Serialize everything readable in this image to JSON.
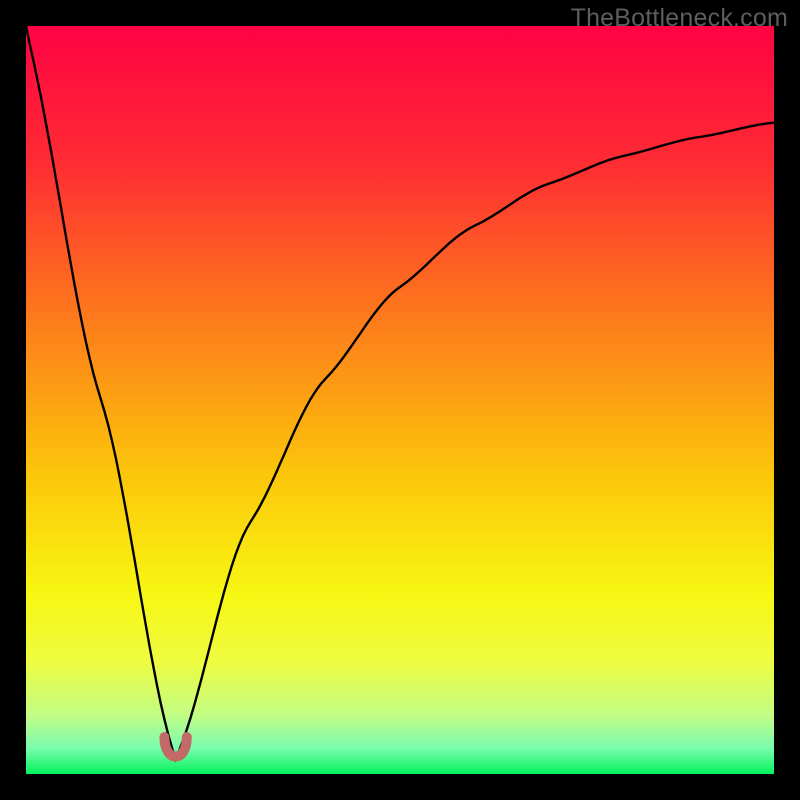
{
  "watermark": {
    "text": "TheBottleneck.com"
  },
  "colors": {
    "frame": "#000000",
    "gradient_stops": [
      {
        "offset": 0.0,
        "color": "#fe0343"
      },
      {
        "offset": 0.18,
        "color": "#fe2b33"
      },
      {
        "offset": 0.4,
        "color": "#fd7e1b"
      },
      {
        "offset": 0.6,
        "color": "#fcc60a"
      },
      {
        "offset": 0.76,
        "color": "#f7f713"
      },
      {
        "offset": 0.85,
        "color": "#eefc41"
      },
      {
        "offset": 0.92,
        "color": "#c3fd83"
      },
      {
        "offset": 0.965,
        "color": "#7bfcb0"
      },
      {
        "offset": 1.0,
        "color": "#04f35c"
      }
    ],
    "curve": "#000000",
    "tip_fill": "#c26a67",
    "tip_stroke": "#bb5f5c"
  },
  "chart_data": {
    "type": "line",
    "title": "",
    "xlabel": "",
    "ylabel": "",
    "x": [
      0,
      10,
      20,
      30,
      40,
      50,
      60,
      70,
      80,
      90,
      100
    ],
    "xlim": [
      0,
      100
    ],
    "ylim": [
      0,
      100
    ],
    "notch_x": 20,
    "series": [
      {
        "name": "bottleneck-curve",
        "values": [
          100,
          55,
          2,
          40,
          59,
          70,
          77,
          82,
          85,
          87,
          89
        ]
      }
    ],
    "tip_marker": {
      "x_range": [
        18.5,
        21.5
      ],
      "y": 2,
      "shape": "u"
    }
  }
}
